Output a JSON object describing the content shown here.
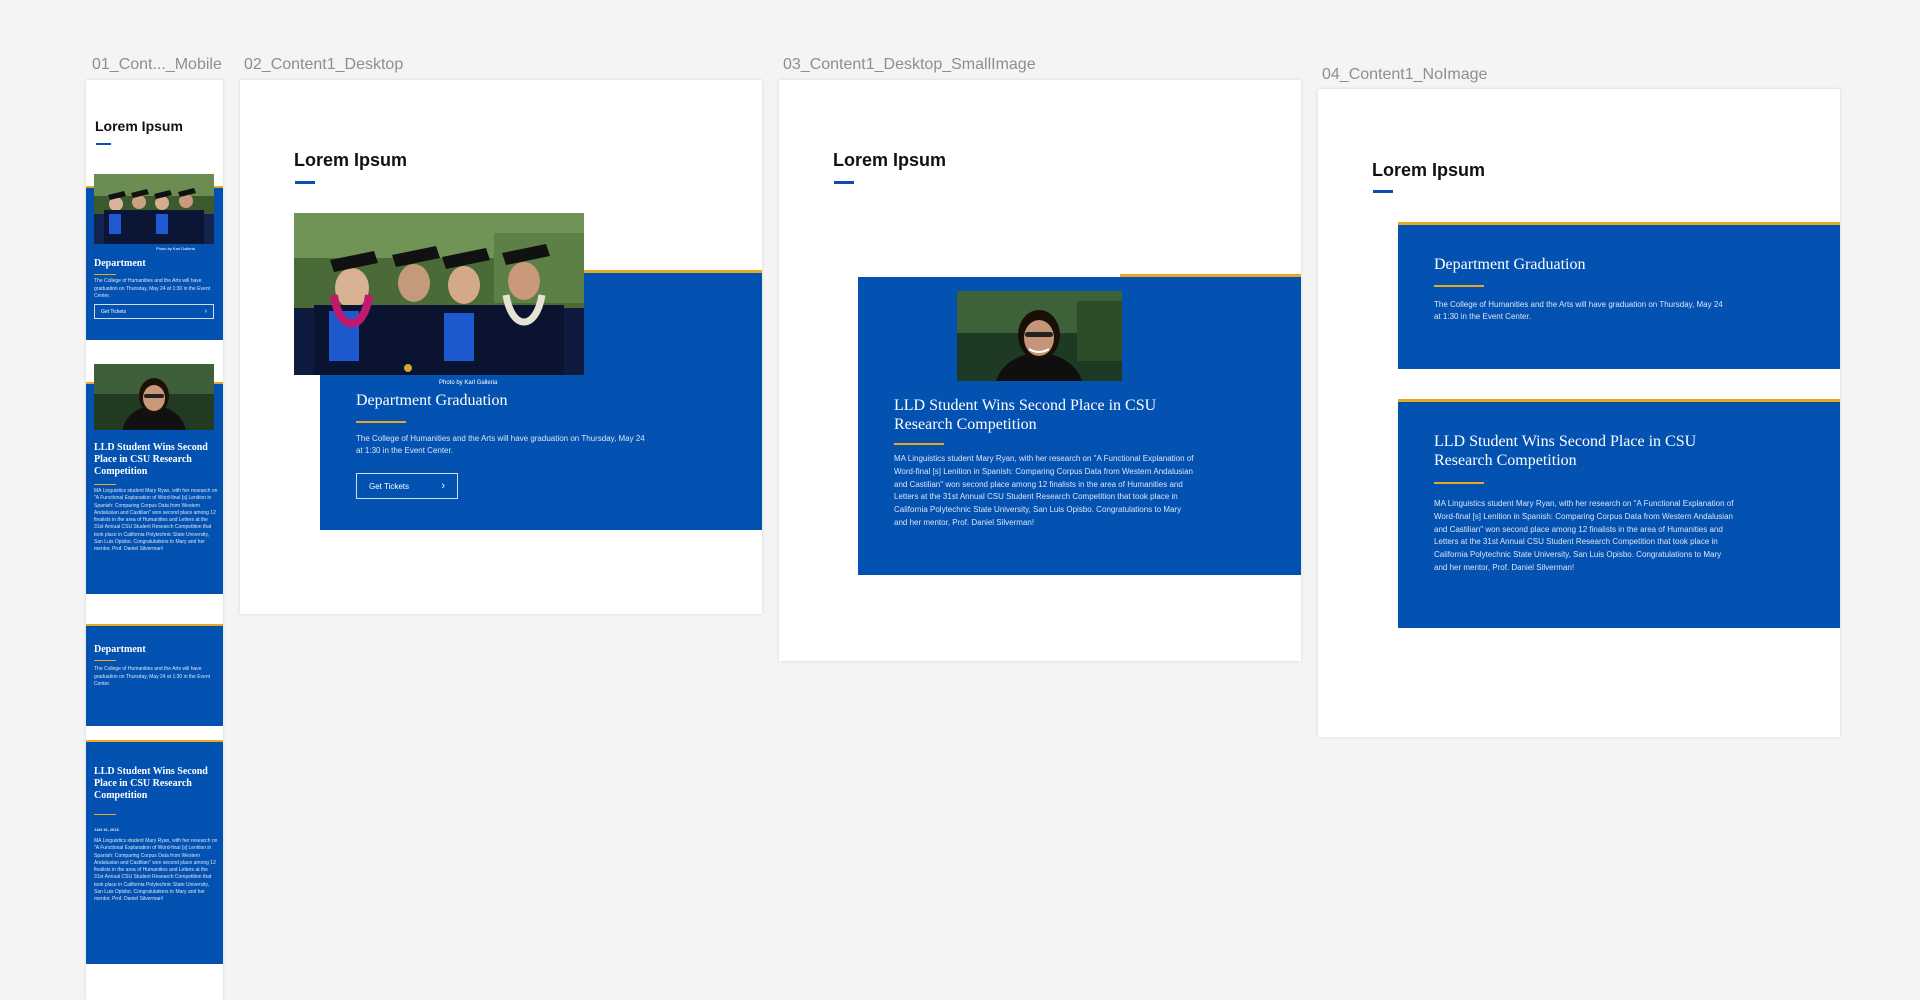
{
  "frames": [
    {
      "id": "01",
      "label": "01_Cont..._Mobile"
    },
    {
      "id": "02",
      "label": "02_Content1_Desktop"
    },
    {
      "id": "03",
      "label": "03_Content1_Desktop_SmallImage"
    },
    {
      "id": "04",
      "label": "04_Content1_NoImage"
    }
  ],
  "section_title": "Lorem Ipsum",
  "graduation": {
    "title": "Department Graduation",
    "title_short": "Department",
    "text": "The College of Humanities and the Arts will have graduation on Thursday, May 24 at 1:30 in the Event Center.",
    "button": "Get Tickets",
    "photo_credit": "Photo by Karl Galleria"
  },
  "lld": {
    "title": "LLD Student Wins Second Place in CSU Research Competition",
    "date": "JAN 16, 2018",
    "text": "MA Linguistics student Mary Ryan, with her research on \"A Functional Explanation of Word-final [s] Lenition in Spanish: Comparing Corpus Data from Western Andalusian and Castilian\" won second place among 12 finalists in the area of Humanities and Letters at the 31st Annual CSU Student Research Competition that took place in California Polytechnic State University, San Luis Opisbo. Congratulations to Mary and her mentor, Prof. Daniel Silverman!"
  },
  "icons": {
    "button_arrow": "chevron-right-icon"
  },
  "colors": {
    "brand_blue": "#0351b0",
    "accent_gold": "#e8a820",
    "page_bg": "#f4f4f4"
  }
}
